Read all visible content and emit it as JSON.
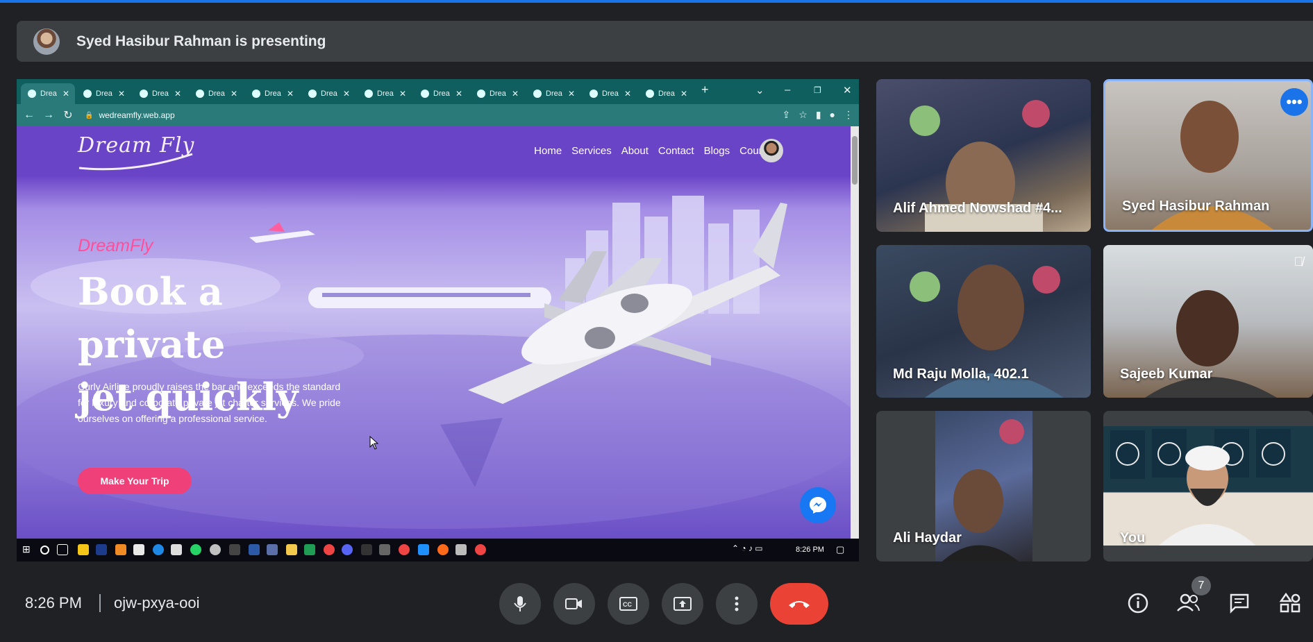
{
  "presenter": {
    "text": "Syed Hasibur Rahman is presenting"
  },
  "shared_screen": {
    "tabs": [
      "Drea",
      "Drea",
      "Drea",
      "Drea",
      "Drea",
      "Drea",
      "Drea",
      "Drea",
      "Drea",
      "Drea",
      "Drea",
      "Drea"
    ],
    "new_tab": "+",
    "url": "wedreamfly.web.app",
    "website": {
      "logo": "Dream Fly",
      "menu": [
        "Home",
        "Services",
        "About",
        "Contact",
        "Blogs",
        "Courses"
      ],
      "brand_dream": "Dream",
      "brand_fly": "Fly",
      "title_line1": "Book a private",
      "title_line2": "jet quickly",
      "description": "Curly Airline proudly raises the bar and exceeds the standard for luxury and corporate private jet charter services. We pride ourselves on offering a professional service.",
      "cta": "Make Your Trip"
    },
    "taskbar_time": "8:26 PM"
  },
  "participants": [
    {
      "name": "Alif Ahmed Nowshad #4..."
    },
    {
      "name": "Syed Hasibur Rahman"
    },
    {
      "name": "Md Raju Molla, 402.1"
    },
    {
      "name": "Sajeeb Kumar"
    },
    {
      "name": "Ali Haydar"
    },
    {
      "name": "You"
    }
  ],
  "bottom_bar": {
    "time": "8:26 PM",
    "meeting_code": "ojw-pxya-ooi",
    "people_count": "7"
  },
  "colors": {
    "end_call": "#ea4335",
    "selected_border": "#8ab4f8",
    "cta": "#f0407a",
    "brand": "#ff4f9a"
  }
}
